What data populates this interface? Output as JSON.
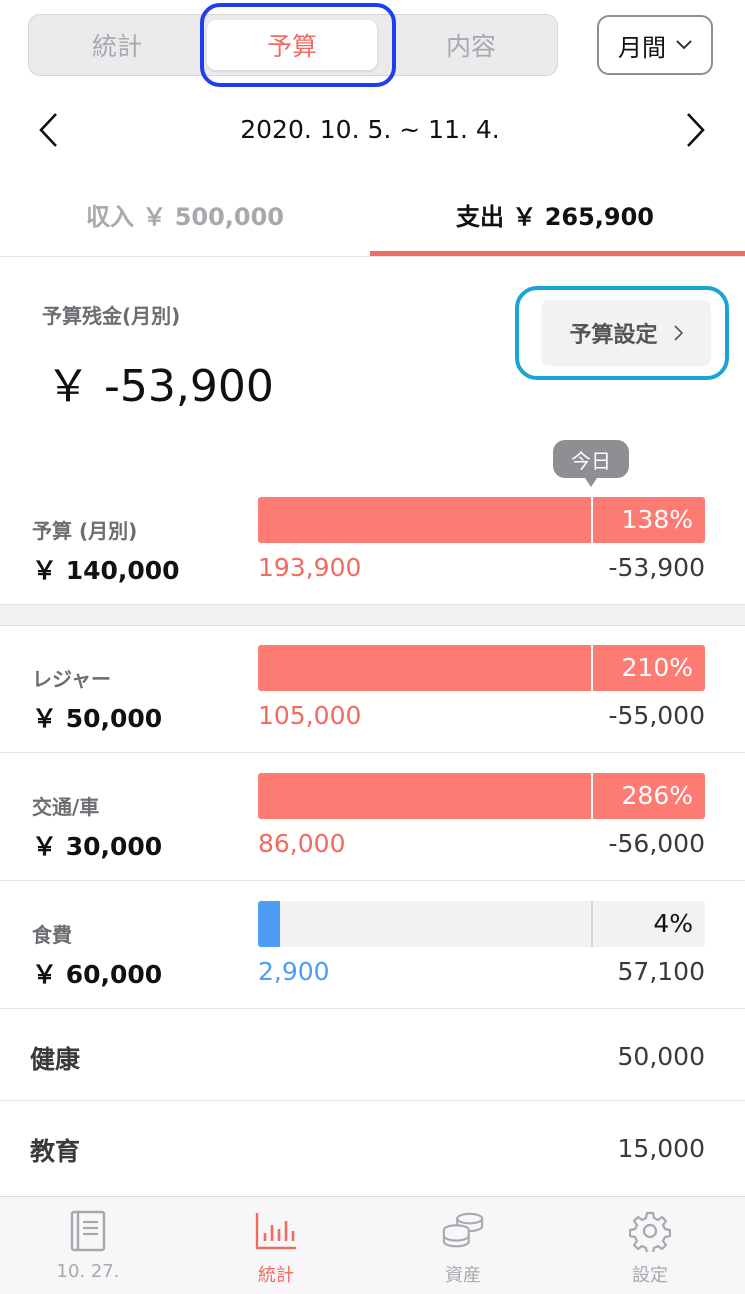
{
  "segments": [
    "統計",
    "予算",
    "内容"
  ],
  "active_segment": 1,
  "period_button": "月間",
  "date_range": "2020. 10. 5. ~ 11. 4.",
  "tabs": {
    "income": "収入 ￥ 500,000",
    "expense": "支出 ￥ 265,900"
  },
  "remaining": {
    "label": "予算残金(月別)",
    "value": "￥ -53,900"
  },
  "budget_setting_button": "予算設定",
  "today_label": "今日",
  "budget_rows": [
    {
      "name": "予算 (月別)",
      "amount": "￥ 140,000",
      "spent": "193,900",
      "remaining": "-53,900",
      "percent": "138%",
      "fill_ratio": 1.0,
      "status": "over"
    },
    {
      "name": "レジャー",
      "amount": "￥ 50,000",
      "spent": "105,000",
      "remaining": "-55,000",
      "percent": "210%",
      "fill_ratio": 1.0,
      "status": "over"
    },
    {
      "name": "交通/車",
      "amount": "￥ 30,000",
      "spent": "86,000",
      "remaining": "-56,000",
      "percent": "286%",
      "fill_ratio": 1.0,
      "status": "over"
    },
    {
      "name": "食費",
      "amount": "￥ 60,000",
      "spent": "2,900",
      "remaining": "57,100",
      "percent": "4%",
      "fill_ratio": 0.05,
      "status": "under"
    }
  ],
  "simple_rows": [
    {
      "name": "健康",
      "value": "50,000"
    },
    {
      "name": "教育",
      "value": "15,000"
    }
  ],
  "tabbar": [
    {
      "label": "10. 27.",
      "icon": "book-icon"
    },
    {
      "label": "統計",
      "icon": "bar-chart-icon"
    },
    {
      "label": "資産",
      "icon": "coins-icon"
    },
    {
      "label": "設定",
      "icon": "gear-icon"
    }
  ],
  "colors": {
    "accent": "#f26b60",
    "under_budget": "#4d9df5",
    "over_budget_bar": "#fd7b73"
  }
}
